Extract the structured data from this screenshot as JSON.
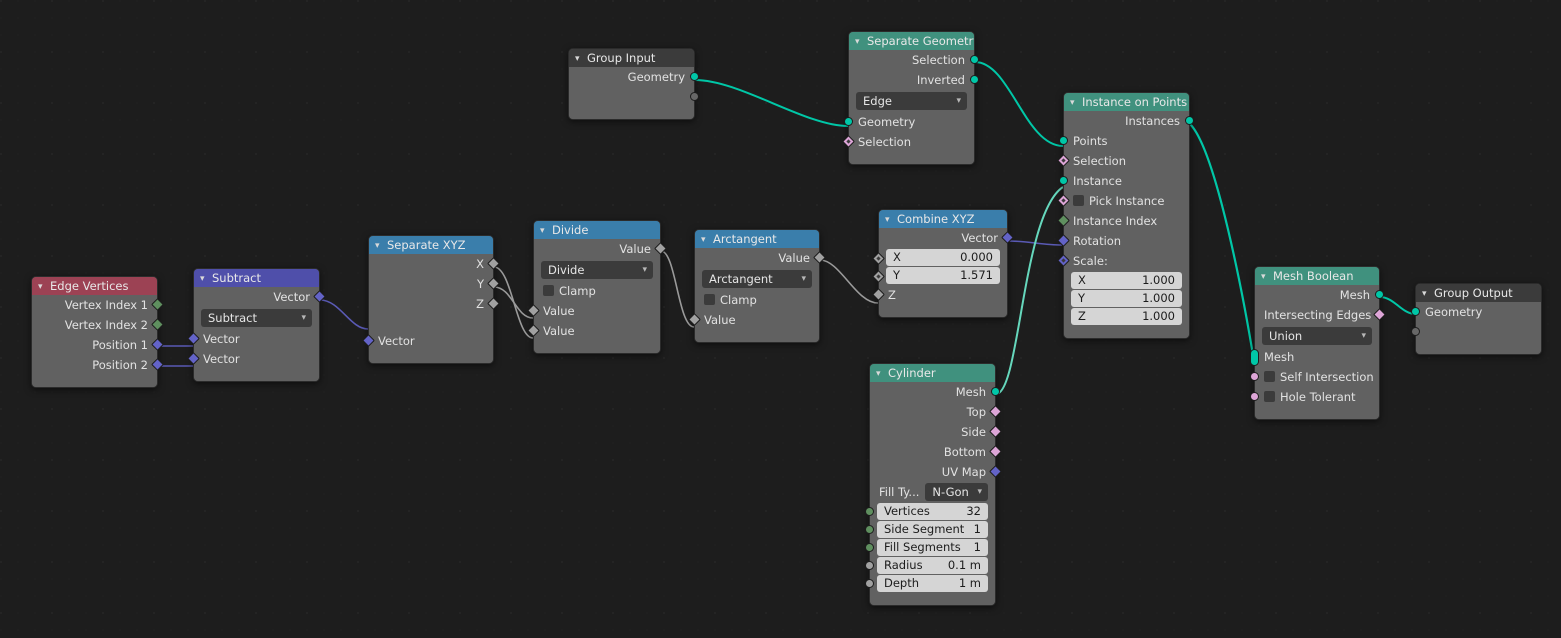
{
  "app": {
    "editor": "Blender Geometry Node Editor",
    "background": "#1d1d1d"
  },
  "colors": {
    "header_geometry": "#40917e",
    "header_converter": "#3a7eab",
    "header_vector": "#4f4faa",
    "header_input": "#9c4254",
    "header_group": "#3b3b3b",
    "socket_geometry": "#00c7a7",
    "socket_vector": "#6363c7",
    "socket_float": "#a1a1a1",
    "socket_int": "#5f8f5f",
    "socket_bool": "#dda5d7"
  },
  "nodes": {
    "edge_vertices": {
      "title": "Edge Vertices",
      "outputs": [
        {
          "label": "Vertex Index 1",
          "socket": "int"
        },
        {
          "label": "Vertex Index 2",
          "socket": "int"
        },
        {
          "label": "Position 1",
          "socket": "vector"
        },
        {
          "label": "Position 2",
          "socket": "vector"
        }
      ]
    },
    "subtract": {
      "title": "Subtract",
      "outputs": [
        {
          "label": "Vector",
          "socket": "vector"
        }
      ],
      "operation": "Subtract",
      "inputs": [
        {
          "label": "Vector",
          "socket": "vector"
        },
        {
          "label": "Vector",
          "socket": "vector"
        }
      ]
    },
    "separate_xyz": {
      "title": "Separate XYZ",
      "outputs": [
        {
          "label": "X",
          "socket": "float"
        },
        {
          "label": "Y",
          "socket": "float"
        },
        {
          "label": "Z",
          "socket": "float"
        }
      ],
      "inputs": [
        {
          "label": "Vector",
          "socket": "vector"
        }
      ]
    },
    "divide": {
      "title": "Divide",
      "outputs": [
        {
          "label": "Value",
          "socket": "float"
        }
      ],
      "operation": "Divide",
      "clamp_label": "Clamp",
      "clamp_checked": false,
      "inputs": [
        {
          "label": "Value",
          "socket": "float"
        },
        {
          "label": "Value",
          "socket": "float"
        }
      ]
    },
    "arctangent": {
      "title": "Arctangent",
      "outputs": [
        {
          "label": "Value",
          "socket": "float"
        }
      ],
      "operation": "Arctangent",
      "clamp_label": "Clamp",
      "clamp_checked": false,
      "inputs": [
        {
          "label": "Value",
          "socket": "float"
        }
      ]
    },
    "combine_xyz": {
      "title": "Combine XYZ",
      "outputs": [
        {
          "label": "Vector",
          "socket": "vector"
        }
      ],
      "fields": [
        {
          "label": "X",
          "value": "0.000",
          "socket": "float"
        },
        {
          "label": "Y",
          "value": "1.571",
          "socket": "float"
        }
      ],
      "inputs": [
        {
          "label": "Z",
          "socket": "float"
        }
      ]
    },
    "group_input": {
      "title": "Group Input",
      "outputs": [
        {
          "label": "Geometry",
          "socket": "geometry"
        },
        {
          "label": "",
          "socket": "none"
        }
      ]
    },
    "separate_geometry": {
      "title": "Separate Geometry",
      "outputs": [
        {
          "label": "Selection",
          "socket": "geometry"
        },
        {
          "label": "Inverted",
          "socket": "geometry"
        }
      ],
      "domain": "Edge",
      "inputs": [
        {
          "label": "Geometry",
          "socket": "geometry"
        },
        {
          "label": "Selection",
          "socket": "bool"
        }
      ]
    },
    "instance_on_points": {
      "title": "Instance on Points",
      "outputs": [
        {
          "label": "Instances",
          "socket": "geometry"
        }
      ],
      "inputs": [
        {
          "label": "Points",
          "socket": "geometry"
        },
        {
          "label": "Selection",
          "socket": "bool"
        },
        {
          "label": "Instance",
          "socket": "geometry"
        },
        {
          "label": "Pick Instance",
          "socket": "bool",
          "checkbox": true
        },
        {
          "label": "Instance Index",
          "socket": "int"
        },
        {
          "label": "Rotation",
          "socket": "vector"
        },
        {
          "label": "Scale:",
          "socket": "vector"
        }
      ],
      "scale_fields": [
        {
          "label": "X",
          "value": "1.000"
        },
        {
          "label": "Y",
          "value": "1.000"
        },
        {
          "label": "Z",
          "value": "1.000"
        }
      ]
    },
    "cylinder": {
      "title": "Cylinder",
      "outputs": [
        {
          "label": "Mesh",
          "socket": "geometry"
        },
        {
          "label": "Top",
          "socket": "bool"
        },
        {
          "label": "Side",
          "socket": "bool"
        },
        {
          "label": "Bottom",
          "socket": "bool"
        },
        {
          "label": "UV Map",
          "socket": "vector"
        }
      ],
      "fill_type_label": "Fill Ty...",
      "fill_type_value": "N-Gon",
      "fields": [
        {
          "label": "Vertices",
          "value": "32",
          "socket": "int"
        },
        {
          "label": "Side Segment",
          "value": "1",
          "socket": "int"
        },
        {
          "label": "Fill Segments",
          "value": "1",
          "socket": "int"
        },
        {
          "label": "Radius",
          "value": "0.1 m",
          "socket": "float"
        },
        {
          "label": "Depth",
          "value": "1 m",
          "socket": "float"
        }
      ]
    },
    "mesh_boolean": {
      "title": "Mesh Boolean",
      "outputs": [
        {
          "label": "Mesh",
          "socket": "geometry"
        },
        {
          "label": "Intersecting Edges",
          "socket": "bool"
        }
      ],
      "operation": "Union",
      "inputs": [
        {
          "label": "Mesh",
          "socket": "geometry",
          "multi": true
        },
        {
          "label": "Self Intersection",
          "socket": "bool",
          "checkbox": true
        },
        {
          "label": "Hole Tolerant",
          "socket": "bool",
          "checkbox": true
        }
      ]
    },
    "group_output": {
      "title": "Group Output",
      "inputs": [
        {
          "label": "Geometry",
          "socket": "geometry"
        },
        {
          "label": "",
          "socket": "none"
        }
      ]
    }
  },
  "links": [
    {
      "from": "group_input.Geometry",
      "to": "separate_geometry.Geometry",
      "color": "#00c7a7"
    },
    {
      "from": "separate_geometry.Selection",
      "to": "instance_on_points.Points",
      "color": "#00c7a7"
    },
    {
      "from": "edge_vertices.Position 1",
      "to": "subtract.Vector1",
      "color": "#6363c7"
    },
    {
      "from": "edge_vertices.Position 2",
      "to": "subtract.Vector2",
      "color": "#6363c7"
    },
    {
      "from": "subtract.Vector",
      "to": "separate_xyz.Vector",
      "color": "#6363c7"
    },
    {
      "from": "separate_xyz.X",
      "to": "divide.Value2",
      "color": "#a1a1a1"
    },
    {
      "from": "separate_xyz.Y",
      "to": "divide.Value1",
      "color": "#a1a1a1"
    },
    {
      "from": "divide.Value",
      "to": "arctangent.Value",
      "color": "#a1a1a1"
    },
    {
      "from": "arctangent.Value",
      "to": "combine_xyz.Z",
      "color": "#a1a1a1"
    },
    {
      "from": "combine_xyz.Vector",
      "to": "instance_on_points.Rotation",
      "color": "#6363c7"
    },
    {
      "from": "cylinder.Mesh",
      "to": "instance_on_points.Instance",
      "color": "#00c7a7"
    },
    {
      "from": "instance_on_points.Instances",
      "to": "mesh_boolean.Mesh",
      "color": "#00c7a7"
    },
    {
      "from": "mesh_boolean.Mesh",
      "to": "group_output.Geometry",
      "color": "#00c7a7"
    }
  ]
}
